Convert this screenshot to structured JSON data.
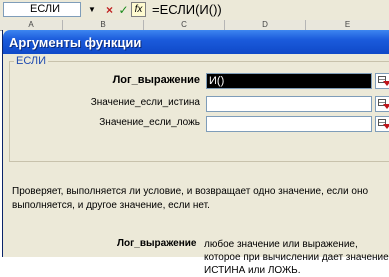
{
  "formula_bar": {
    "name_box": "ЕСЛИ",
    "name_dropdown_icon": "triangle-down",
    "cancel_icon": "×",
    "enter_icon": "✓",
    "fx_label": "fx",
    "formula": "=ЕСЛИ(И())"
  },
  "columns": [
    "A",
    "B",
    "C",
    "D",
    "E"
  ],
  "dialog": {
    "title": "Аргументы функции",
    "function_name": "ЕСЛИ",
    "arguments": [
      {
        "label": "Лог_выражение",
        "value": "И()",
        "bold": true
      },
      {
        "label": "Значение_если_истина",
        "value": "",
        "bold": false
      },
      {
        "label": "Значение_если_ложь",
        "value": "",
        "bold": false
      }
    ],
    "description": "Проверяет, выполняется ли условие, и возвращает одно значение, если оно выполняется, и другое значение, если нет.",
    "arg_detail_label": "Лог_выражение",
    "arg_detail_text": "любое значение или выражение, которое при вычислении дает значение ИСТИНА или ЛОЖЬ."
  },
  "colors": {
    "title_bar": "#1b5bdc",
    "dialog_bg": "#ece9d8",
    "legend_text": "#1f4bb0"
  }
}
